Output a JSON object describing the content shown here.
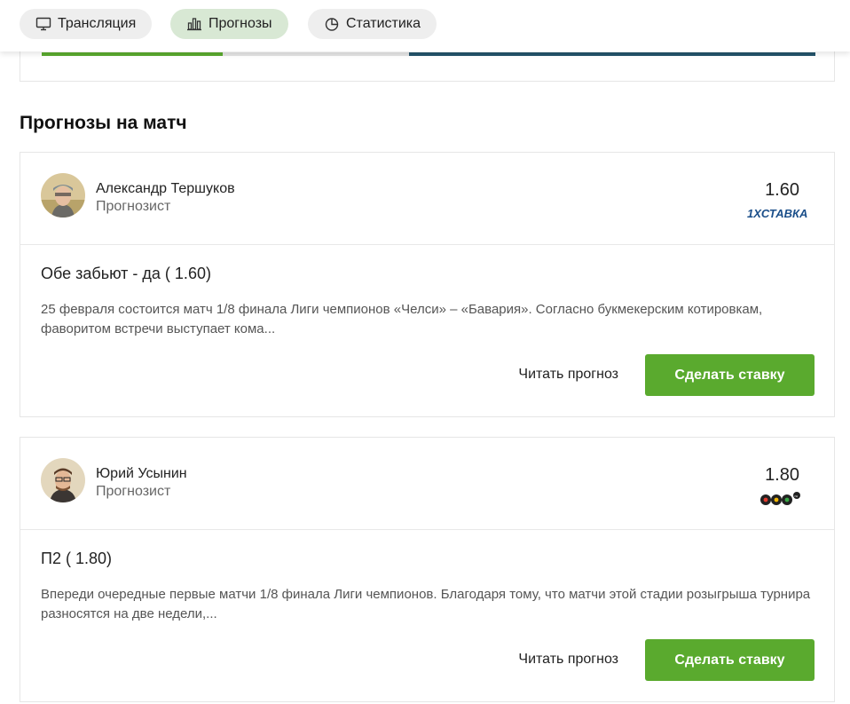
{
  "tabs": [
    {
      "label": "Трансляция",
      "icon": "monitor-icon",
      "active": false
    },
    {
      "label": "Прогнозы",
      "icon": "bar-chart-icon",
      "active": true
    },
    {
      "label": "Статистика",
      "icon": "pie-chart-icon",
      "active": false
    }
  ],
  "section_title": "Прогнозы на матч",
  "forecasts": [
    {
      "author": "Александр Тершуков",
      "role": "Прогнозист",
      "odds": "1.60",
      "bookmaker": "1XСТАВКА",
      "pick": "Обе забьют - да ( 1.60)",
      "description": "25 февраля состоится матч 1/8 финала Лиги чемпионов «Челси» – «Бавария». Согласно букмекерским котировкам, фаворитом встречи выступает кома...",
      "read_label": "Читать прогноз",
      "bet_label": "Сделать ставку"
    },
    {
      "author": "Юрий Усынин",
      "role": "Прогнозист",
      "odds": "1.80",
      "bookmaker": "888",
      "bookmaker_suffix": "ru",
      "pick": "П2 ( 1.80)",
      "description": "Впереди очередные первые матчи 1/8 финала Лиги чемпионов. Благодаря тому, что матчи этой стадии розыгрыша турнира разносятся на две недели,...",
      "read_label": "Читать прогноз",
      "bet_label": "Сделать ставку"
    }
  ],
  "colors": {
    "accent_green": "#5aaa2e",
    "active_tab_bg": "#d8e8d4",
    "progress_blue": "#24546b",
    "bookmaker_1x_blue": "#1b6fb3"
  }
}
